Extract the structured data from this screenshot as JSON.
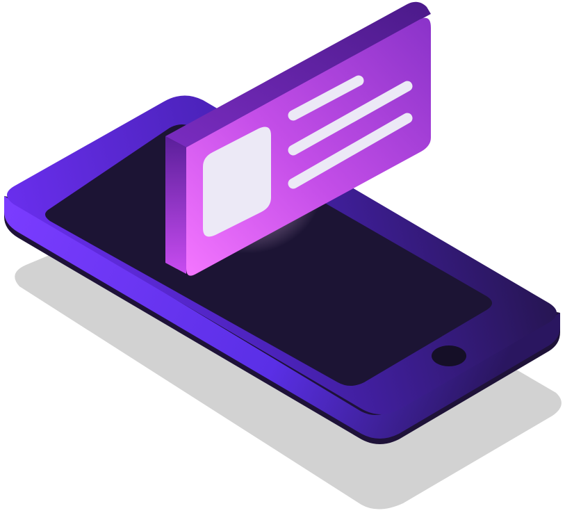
{
  "illustration": {
    "subject": "isometric-phone-with-floating-card-icon",
    "icons": {
      "phone": "smartphone-icon",
      "home_button": "home-button-icon",
      "card": "content-card-icon",
      "thumbnail": "image-placeholder-icon",
      "text_lines": "text-lines-icon"
    },
    "colors": {
      "background": "#ffffff",
      "shadow": "#d2d2d2",
      "phone_body_light": "#6b2ff0",
      "phone_body_mid": "#4a22b8",
      "phone_body_dark": "#2a1660",
      "phone_edge": "#1e1238",
      "phone_screen": "#1c1434",
      "home_button": "#150f27",
      "card_front_light": "#ee6cff",
      "card_front_mid": "#c44ee8",
      "card_front_dark": "#7d2cc0",
      "card_edge": "#5a1f9a",
      "card_content": "#ece9f6"
    }
  }
}
